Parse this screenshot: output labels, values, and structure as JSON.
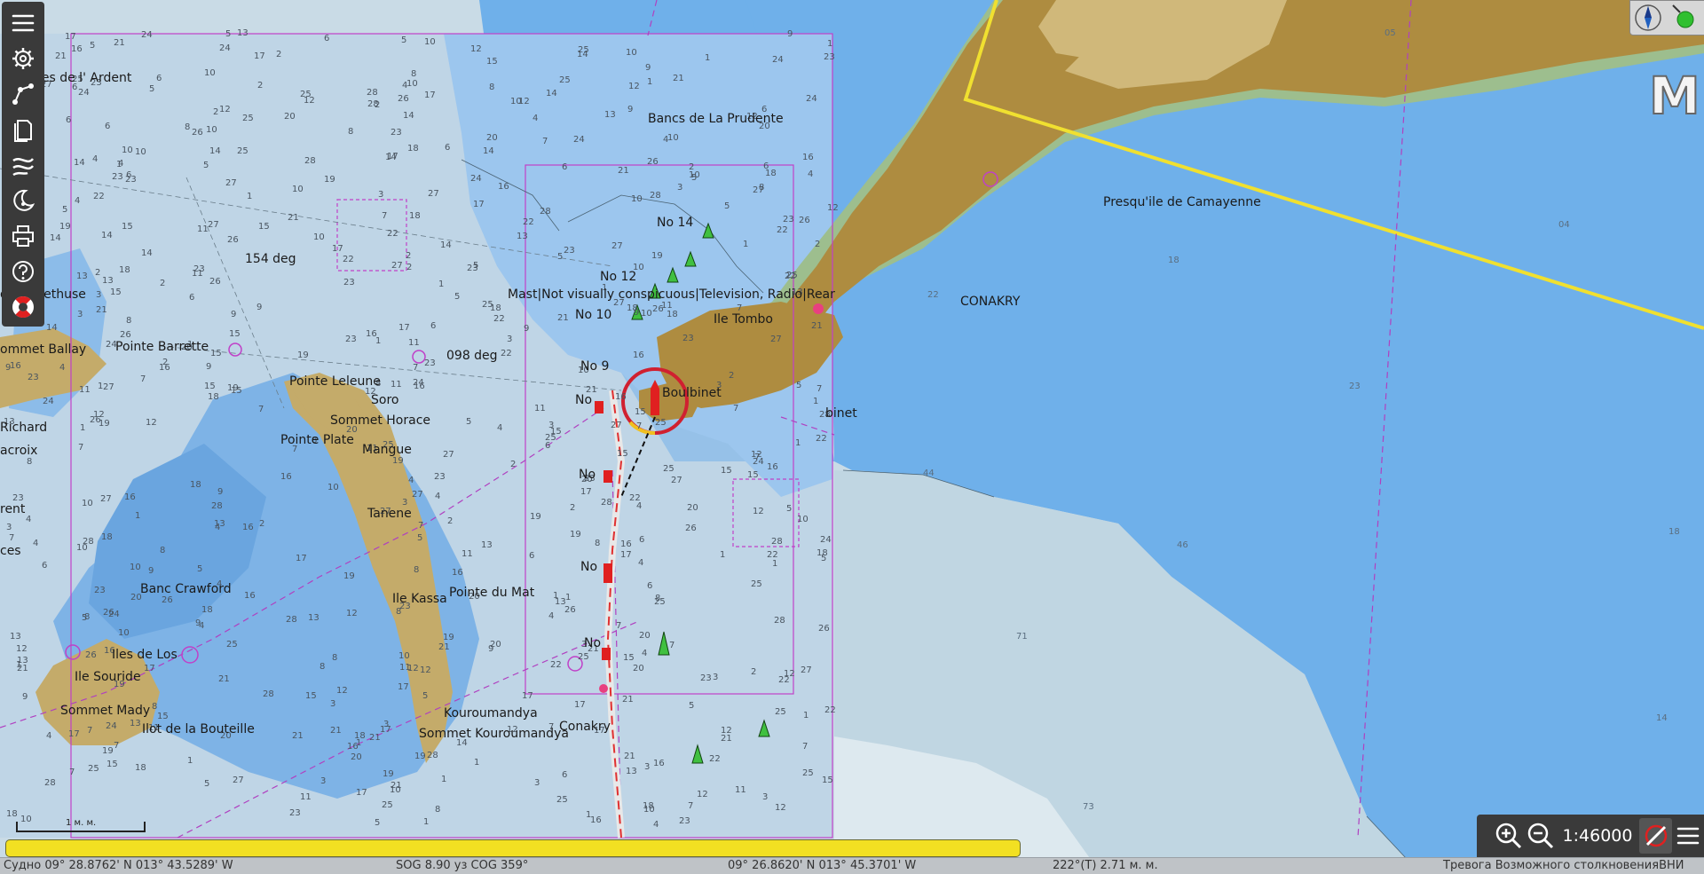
{
  "toolbar": {
    "items": [
      {
        "name": "menu-icon"
      },
      {
        "name": "gear-icon"
      },
      {
        "name": "route-icon"
      },
      {
        "name": "documents-icon"
      },
      {
        "name": "track-icon"
      },
      {
        "name": "night-mode-icon"
      },
      {
        "name": "print-icon"
      },
      {
        "name": "help-icon"
      },
      {
        "name": "lifebuoy-icon"
      }
    ]
  },
  "map": {
    "place_labels": [
      "nes de l' Ardent",
      "Bancs de La Prudente",
      "154 deg",
      "de l' Arethuse",
      "Pointe Barrette",
      "ommet Ballay",
      "098 deg",
      "Pointe Leleune",
      "Soro",
      "Sommet Horace",
      "Pointe Plate",
      "Mangue",
      "Richard",
      "acroix",
      "rent",
      "Tanene",
      "ces",
      "Banc Crawford",
      "Ile Kassa",
      "Pointe du Mat",
      "Iles de Los",
      "Ile Souride",
      "Sommet Mady",
      "Ilot de la Bouteille",
      "Kouroumandya",
      "Sommet Kouroumandya",
      "Conakry",
      "No 14",
      "No 12",
      "Mast|Not visually conspicuous|Television, Radio|Rear",
      "No 10",
      "Ile Tombo",
      "No 9",
      "No",
      "Boulbinet",
      "binet",
      "No",
      "No",
      "No",
      "Presqu'ile de Camayenne",
      "CONAKRY"
    ]
  },
  "compass": {
    "name": "compass-icon"
  },
  "mode": {
    "letter": "M"
  },
  "scalebar": {
    "label": "1 м. м."
  },
  "zoom": {
    "scale": "1:46000"
  },
  "status": {
    "vessel_position": "Судно 09° 28.8762' N   013° 43.5289' W",
    "sog_cog": "SOG 8.90 уз   COG 359°",
    "cursor_position": "09° 26.8620' N   013° 45.3701' W",
    "bearing_distance": "222°(T)  2.71 м. м.",
    "alarm": "Тревога Возможного столкновенияВНИ"
  },
  "colors": {
    "land": "#ae8c40",
    "land_light": "#d0b87a",
    "deep_water": "#6fb0ea",
    "shallow": "#a5cff2",
    "medium": "#c8dbe6",
    "alarm": "#f2e022",
    "route": "#f0e030"
  }
}
